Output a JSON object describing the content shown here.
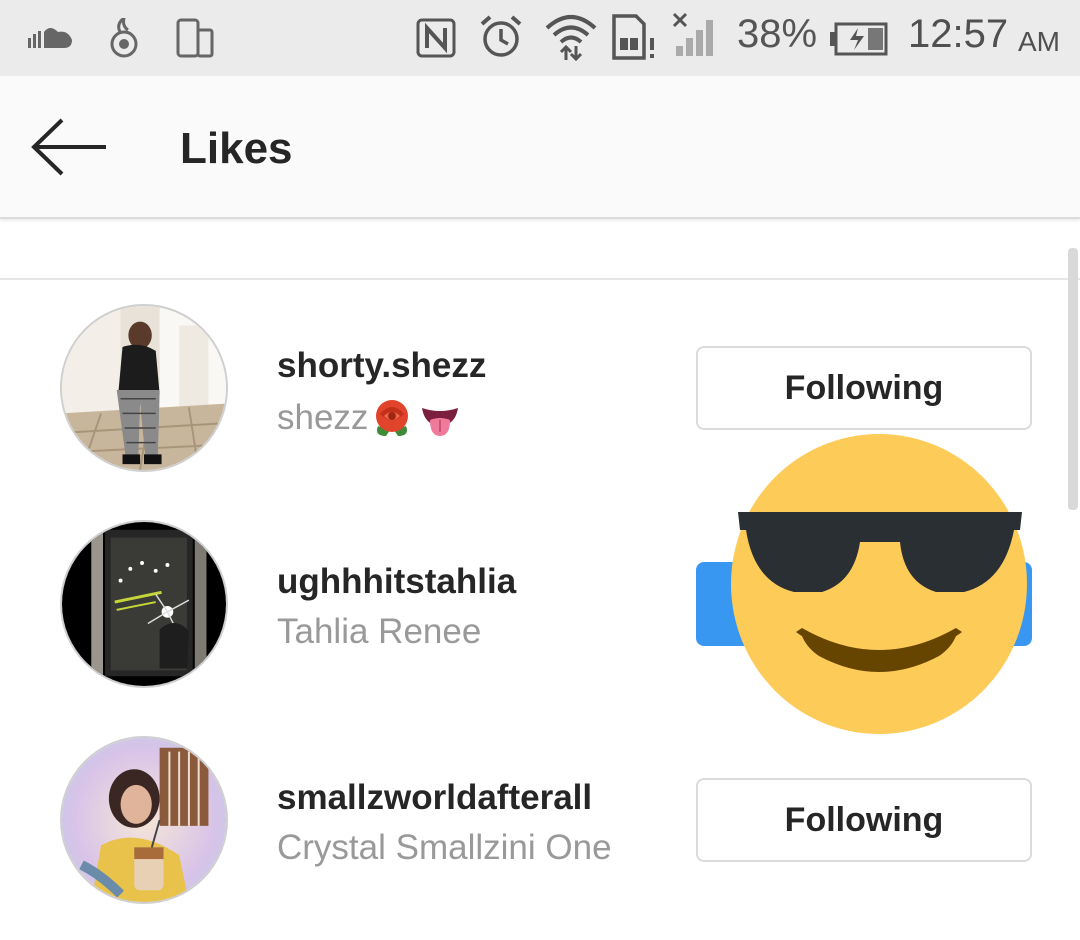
{
  "status_bar": {
    "battery": "38%",
    "time": "12:57",
    "ampm": "AM",
    "icons": [
      "soundcloud-icon",
      "app-notification-icon",
      "screen-rotate-icon",
      "nfc-icon",
      "alarm-icon",
      "wifi-icon",
      "sim-alert-icon",
      "signal-icon",
      "battery-icon"
    ]
  },
  "header": {
    "title": "Likes",
    "back_icon": "arrow-left-icon"
  },
  "likes": [
    {
      "username": "shorty.shezz",
      "full_name": "shezz",
      "emojis": [
        "rose",
        "tongue"
      ],
      "button": "Following"
    },
    {
      "username": "ughhhitstahlia",
      "full_name": "Tahlia Renee",
      "button": ""
    },
    {
      "username": "smallzworldafterall",
      "full_name": "Crystal Smallzini One",
      "button": "Following"
    }
  ],
  "overlay_sticker": "smiling-face-with-sunglasses",
  "colors": {
    "follow_blue": "#3897f0",
    "status_bg": "#ebebeb",
    "header_bg": "#fafafa",
    "sticker_yellow": "#fdcb58"
  }
}
